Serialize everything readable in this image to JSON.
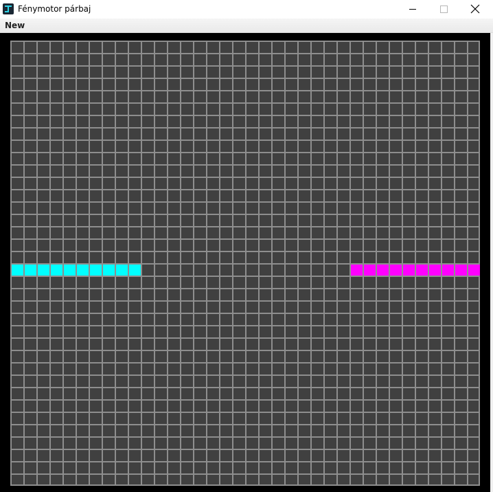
{
  "window": {
    "title": "Fénymotor párbaj"
  },
  "titlebar": {
    "app_icon": "game-app-icon",
    "controls": [
      "minimize-icon",
      "maximize-icon",
      "close-icon"
    ]
  },
  "menu": {
    "items": [
      {
        "label": "New"
      }
    ]
  },
  "board": {
    "columns": 36,
    "rows": 36,
    "background_color": "#404040",
    "grid_line_color": "#8e8e8e",
    "players": [
      {
        "color": "#00ffff",
        "row": 18,
        "cells": [
          0,
          1,
          2,
          3,
          4,
          5,
          6,
          7,
          8,
          9
        ]
      },
      {
        "color": "#ff00ff",
        "row": 18,
        "cells": [
          26,
          27,
          28,
          29,
          30,
          31,
          32,
          33,
          34,
          35
        ]
      }
    ]
  }
}
